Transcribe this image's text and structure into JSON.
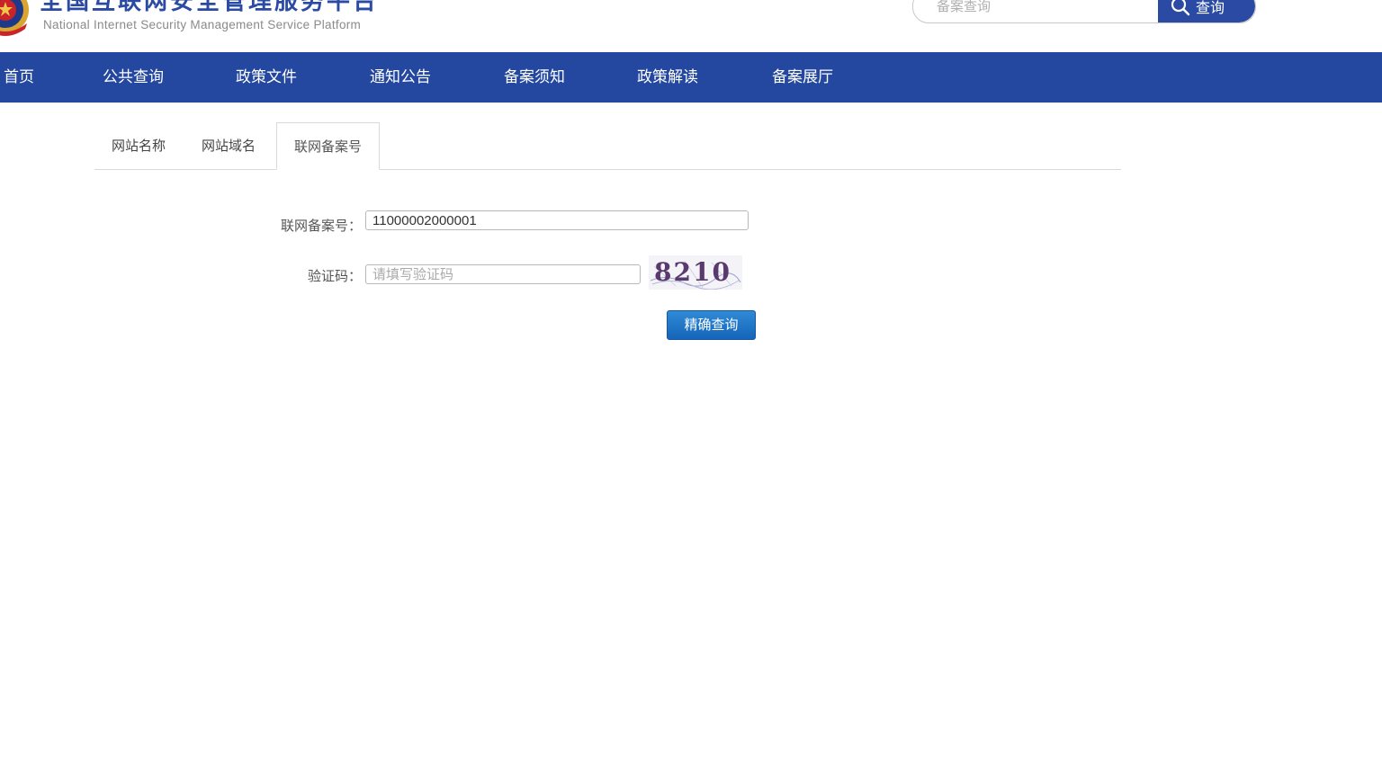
{
  "header": {
    "title": "全国互联网安全管理服务平台",
    "subtitle": "National Internet Security Management Service Platform",
    "emblem_icon": "police-emblem-icon",
    "search": {
      "placeholder": "备案查询",
      "value": "",
      "button_label": "查询",
      "button_icon": "search-icon"
    }
  },
  "nav": {
    "items": [
      {
        "label": "首页"
      },
      {
        "label": "公共查询"
      },
      {
        "label": "政策文件"
      },
      {
        "label": "通知公告"
      },
      {
        "label": "备案须知"
      },
      {
        "label": "政策解读"
      },
      {
        "label": "备案展厅"
      }
    ]
  },
  "tabs": {
    "items": [
      {
        "label": "网站名称",
        "active": false
      },
      {
        "label": "网站域名",
        "active": false
      },
      {
        "label": "联网备案号",
        "active": true
      }
    ]
  },
  "form": {
    "record_number": {
      "label": "联网备案号：",
      "value": "11000002000001"
    },
    "captcha": {
      "label": "验证码：",
      "placeholder": "请填写验证码",
      "value": "",
      "image_text": "8210"
    },
    "submit_label": "精确查询"
  },
  "colors": {
    "brand_blue": "#2448a0",
    "button_blue": "#1f78c8",
    "border_gray": "#d9d9d9"
  }
}
